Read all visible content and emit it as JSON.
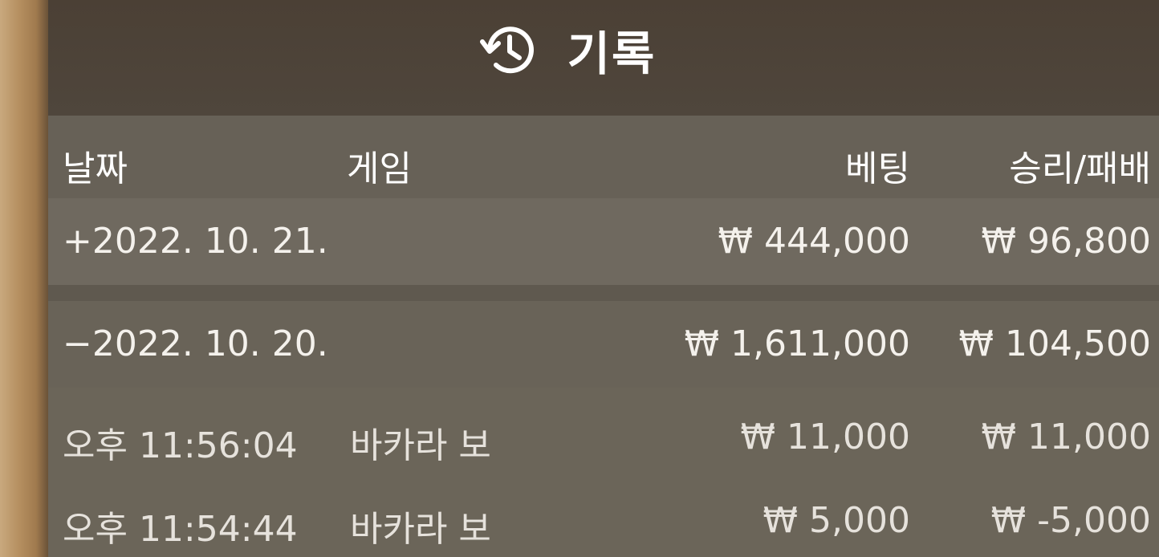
{
  "header": {
    "title": "기록",
    "icon": "history-icon"
  },
  "columns": {
    "date": "날짜",
    "game": "게임",
    "bet": "베팅",
    "win_loss": "승리/패배"
  },
  "days": [
    {
      "date": "+2022. 10. 21.",
      "bet": "₩ 444,000",
      "win_loss": "₩ 96,800"
    },
    {
      "date": "−2022. 10. 20.",
      "bet": "₩ 1,611,000",
      "win_loss": "₩ 104,500"
    }
  ],
  "entries": [
    {
      "time": "오후 11:56:04",
      "game": "바카라 보",
      "bet": "₩ 11,000",
      "win_loss": "₩ 11,000"
    },
    {
      "time": "오후 11:54:44",
      "game": "바카라 보",
      "bet": "₩ 5,000",
      "win_loss": "₩ -5,000"
    }
  ],
  "colors": {
    "header_bg": "#4b4035",
    "panel_bg": "#6a6459",
    "frame": "#b8976c",
    "text": "#ffffff"
  }
}
